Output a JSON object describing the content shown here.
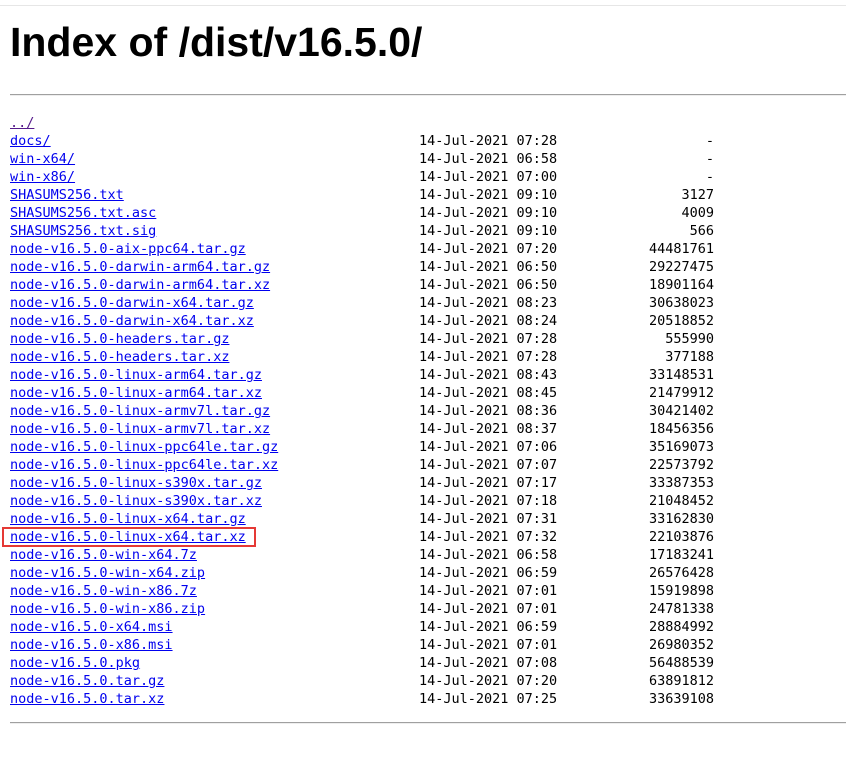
{
  "page": {
    "title": "Index of /dist/v16.5.0/"
  },
  "parent_link": "../",
  "highlight_color": "#e53935",
  "entries": [
    {
      "name": "docs/",
      "date": "14-Jul-2021 07:28",
      "size": "-"
    },
    {
      "name": "win-x64/",
      "date": "14-Jul-2021 06:58",
      "size": "-"
    },
    {
      "name": "win-x86/",
      "date": "14-Jul-2021 07:00",
      "size": "-"
    },
    {
      "name": "SHASUMS256.txt",
      "date": "14-Jul-2021 09:10",
      "size": "3127"
    },
    {
      "name": "SHASUMS256.txt.asc",
      "date": "14-Jul-2021 09:10",
      "size": "4009"
    },
    {
      "name": "SHASUMS256.txt.sig",
      "date": "14-Jul-2021 09:10",
      "size": "566"
    },
    {
      "name": "node-v16.5.0-aix-ppc64.tar.gz",
      "date": "14-Jul-2021 07:20",
      "size": "44481761"
    },
    {
      "name": "node-v16.5.0-darwin-arm64.tar.gz",
      "date": "14-Jul-2021 06:50",
      "size": "29227475"
    },
    {
      "name": "node-v16.5.0-darwin-arm64.tar.xz",
      "date": "14-Jul-2021 06:50",
      "size": "18901164"
    },
    {
      "name": "node-v16.5.0-darwin-x64.tar.gz",
      "date": "14-Jul-2021 08:23",
      "size": "30638023"
    },
    {
      "name": "node-v16.5.0-darwin-x64.tar.xz",
      "date": "14-Jul-2021 08:24",
      "size": "20518852"
    },
    {
      "name": "node-v16.5.0-headers.tar.gz",
      "date": "14-Jul-2021 07:28",
      "size": "555990"
    },
    {
      "name": "node-v16.5.0-headers.tar.xz",
      "date": "14-Jul-2021 07:28",
      "size": "377188"
    },
    {
      "name": "node-v16.5.0-linux-arm64.tar.gz",
      "date": "14-Jul-2021 08:43",
      "size": "33148531"
    },
    {
      "name": "node-v16.5.0-linux-arm64.tar.xz",
      "date": "14-Jul-2021 08:45",
      "size": "21479912"
    },
    {
      "name": "node-v16.5.0-linux-armv7l.tar.gz",
      "date": "14-Jul-2021 08:36",
      "size": "30421402"
    },
    {
      "name": "node-v16.5.0-linux-armv7l.tar.xz",
      "date": "14-Jul-2021 08:37",
      "size": "18456356"
    },
    {
      "name": "node-v16.5.0-linux-ppc64le.tar.gz",
      "date": "14-Jul-2021 07:06",
      "size": "35169073"
    },
    {
      "name": "node-v16.5.0-linux-ppc64le.tar.xz",
      "date": "14-Jul-2021 07:07",
      "size": "22573792"
    },
    {
      "name": "node-v16.5.0-linux-s390x.tar.gz",
      "date": "14-Jul-2021 07:17",
      "size": "33387353"
    },
    {
      "name": "node-v16.5.0-linux-s390x.tar.xz",
      "date": "14-Jul-2021 07:18",
      "size": "21048452"
    },
    {
      "name": "node-v16.5.0-linux-x64.tar.gz",
      "date": "14-Jul-2021 07:31",
      "size": "33162830"
    },
    {
      "name": "node-v16.5.0-linux-x64.tar.xz",
      "date": "14-Jul-2021 07:32",
      "size": "22103876",
      "highlighted": true
    },
    {
      "name": "node-v16.5.0-win-x64.7z",
      "date": "14-Jul-2021 06:58",
      "size": "17183241"
    },
    {
      "name": "node-v16.5.0-win-x64.zip",
      "date": "14-Jul-2021 06:59",
      "size": "26576428"
    },
    {
      "name": "node-v16.5.0-win-x86.7z",
      "date": "14-Jul-2021 07:01",
      "size": "15919898"
    },
    {
      "name": "node-v16.5.0-win-x86.zip",
      "date": "14-Jul-2021 07:01",
      "size": "24781338"
    },
    {
      "name": "node-v16.5.0-x64.msi",
      "date": "14-Jul-2021 06:59",
      "size": "28884992"
    },
    {
      "name": "node-v16.5.0-x86.msi",
      "date": "14-Jul-2021 07:01",
      "size": "26980352"
    },
    {
      "name": "node-v16.5.0.pkg",
      "date": "14-Jul-2021 07:08",
      "size": "56488539"
    },
    {
      "name": "node-v16.5.0.tar.gz",
      "date": "14-Jul-2021 07:20",
      "size": "63891812"
    },
    {
      "name": "node-v16.5.0.tar.xz",
      "date": "14-Jul-2021 07:25",
      "size": "33639108"
    }
  ]
}
